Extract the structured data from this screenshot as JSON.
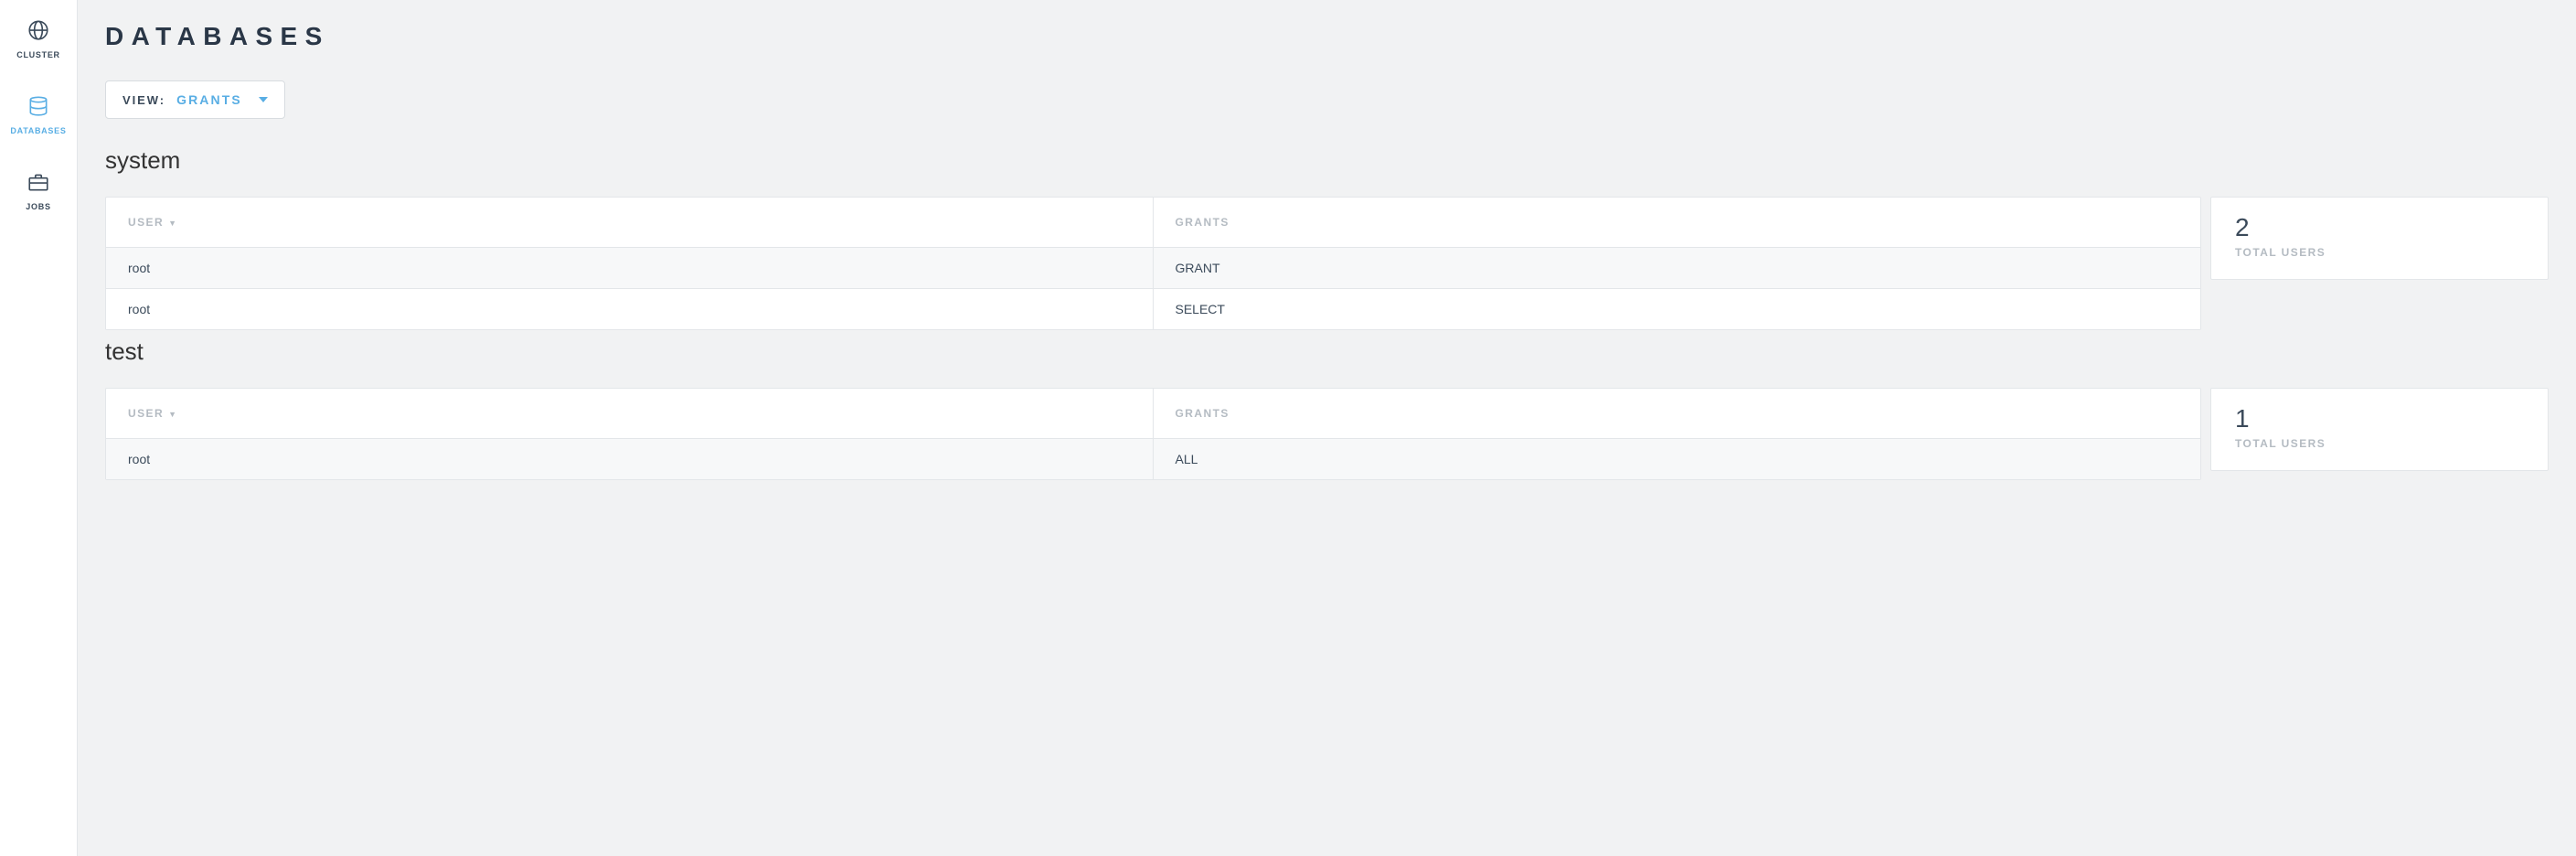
{
  "sidebar": {
    "items": [
      {
        "label": "CLUSTER"
      },
      {
        "label": "DATABASES"
      },
      {
        "label": "JOBS"
      }
    ]
  },
  "header": {
    "title": "DATABASES"
  },
  "view_selector": {
    "prefix": "VIEW:",
    "value": "GRANTS"
  },
  "columns": {
    "user": "USER",
    "grants": "GRANTS"
  },
  "stats_label": "TOTAL USERS",
  "databases": [
    {
      "name": "system",
      "total_users": "2",
      "rows": [
        {
          "user": "root",
          "grant": "GRANT"
        },
        {
          "user": "root",
          "grant": "SELECT"
        }
      ]
    },
    {
      "name": "test",
      "total_users": "1",
      "rows": [
        {
          "user": "root",
          "grant": "ALL"
        }
      ]
    }
  ]
}
